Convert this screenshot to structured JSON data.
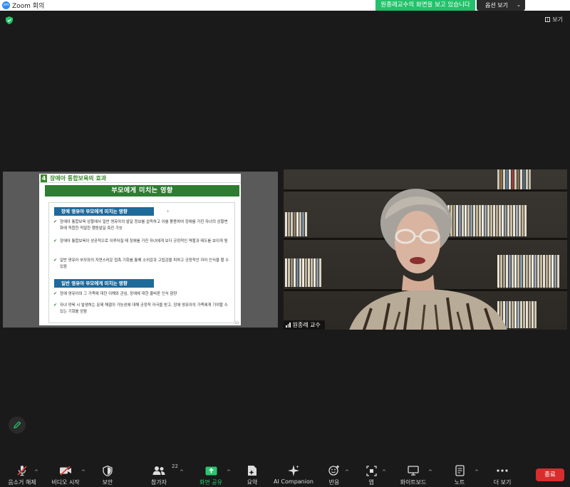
{
  "window": {
    "app_icon": "zoom-logo",
    "app_icon_text": "zm",
    "title": "Zoom 회의"
  },
  "share_banner": {
    "text": "원종례교수의 화면을 보고 있습니다",
    "color": "#23c16b"
  },
  "view_options": {
    "label": "옵션 보기"
  },
  "view_button": {
    "label": "보기"
  },
  "slide": {
    "number": "4",
    "section": "장애아 통합보육의 효과",
    "title": "부모에게 미치는 영향",
    "sub1": "장애 영유아 부모에게 미치는 영향",
    "bullets1": [
      "장애아 통합보육 상황에서 일반 영유아의 발달 정보를 습득하고 이를 활용하여 장애를 가진 자녀의 상황변화에 적합한 적절한 행동발달 촉진 가능",
      "장애아 통합보육이 성공적으로 이루어질 때 장애를 가진 자녀에게 보다 긍정적인 역할과 태도를 보이게 됨",
      "일반 영유아 부모와의 자연스러운 접촉 기회를 통해 소외감과 고립감을 피하고 긍정적인 자아 인식을 할 수 있음"
    ],
    "sub2": "일반 영유아 부모에게 미치는 영향",
    "bullets2": [
      "장애 영유아와 그 가족에 대한 이해와 관심, 장애에 대한 올바른 인식 함양",
      "자녀 양육 시 발생하는 문제 해결의 가능성에 대해 긍정적 자극을 받고, 장애 영유아의 가족에게 기여할 수 있는 기회를 얻음"
    ],
    "page": "33",
    "accent": "#2e7d32",
    "sub_color": "#1e6a9a"
  },
  "video": {
    "participant_name": "원종례 교수"
  },
  "toolbar": {
    "mute": "음소거 해제",
    "video": "비디오 시작",
    "security": "보안",
    "participants": "참가자",
    "participants_count": "22",
    "share": "화면 공유",
    "summary": "요약",
    "ai": "AI Companion",
    "reactions": "반응",
    "apps": "앱",
    "whiteboard": "화이트보드",
    "notes": "노트",
    "more": "더 보기",
    "end": "종료",
    "share_color": "#28c76f",
    "end_color": "#d72d2d"
  }
}
